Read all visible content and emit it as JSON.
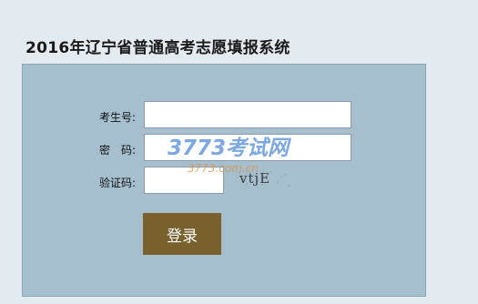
{
  "page": {
    "title": "2016年辽宁省普通高考志愿填报系统"
  },
  "login_form": {
    "exam_number_label": "考生号:",
    "exam_number_value": "",
    "password_label": "密　码:",
    "password_value": "",
    "captcha_label": "验证码:",
    "captcha_value": "",
    "captcha_image_text": "vtjE",
    "login_button_label": "登录"
  },
  "watermark": {
    "main_text": "3773考试网",
    "sub_text": "3773.com.cn"
  },
  "colors": {
    "page_background": "#e3ebf1",
    "panel_background": "#a5bfce",
    "button_background": "#79612e",
    "watermark_blue": "#4a86d4",
    "watermark_orange": "#e38a3c"
  }
}
